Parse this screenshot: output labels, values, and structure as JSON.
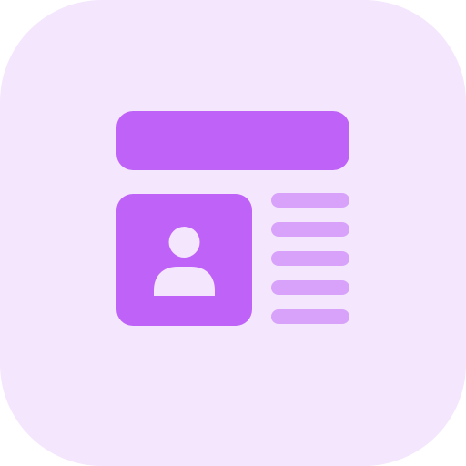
{
  "icon": {
    "name": "profile-page-icon",
    "colors": {
      "background": "#f4e6fd",
      "primary": "#bf63f8",
      "secondary": "#d8a2fb",
      "figure": "#f4e6fd"
    },
    "elements": {
      "header": "header-bar",
      "card": "profile-card",
      "avatar": "person-icon",
      "text_lines": 5
    }
  }
}
